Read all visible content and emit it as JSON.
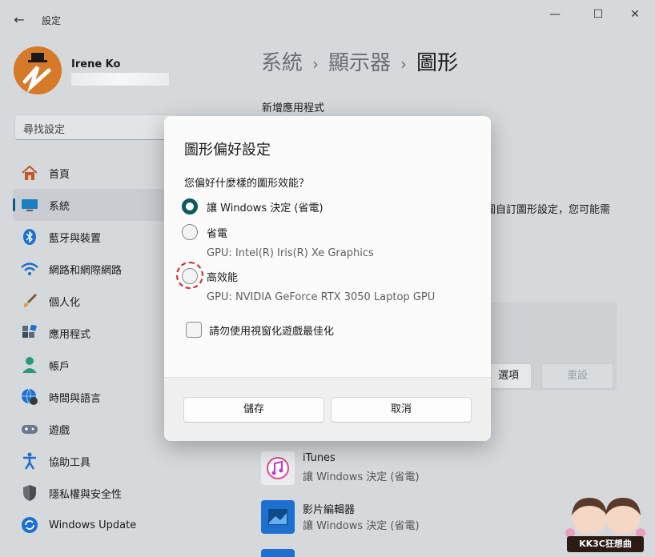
{
  "window": {
    "title": "設定",
    "back_glyph": "←",
    "minimize_glyph": "—",
    "maximize_glyph": "☐",
    "close_glyph": "✕"
  },
  "profile": {
    "name": "Irene Ko"
  },
  "search": {
    "placeholder": "尋找設定"
  },
  "sidebar": {
    "items": [
      {
        "label": "首頁",
        "icon": "home-icon"
      },
      {
        "label": "系統",
        "icon": "monitor-icon",
        "selected": true
      },
      {
        "label": "藍牙與裝置",
        "icon": "bluetooth-icon"
      },
      {
        "label": "網路和網際網路",
        "icon": "wifi-icon"
      },
      {
        "label": "個人化",
        "icon": "brush-icon"
      },
      {
        "label": "應用程式",
        "icon": "apps-icon"
      },
      {
        "label": "帳戶",
        "icon": "person-icon"
      },
      {
        "label": "時間與語言",
        "icon": "globe-clock-icon"
      },
      {
        "label": "遊戲",
        "icon": "gamepad-icon"
      },
      {
        "label": "協助工具",
        "icon": "accessibility-icon"
      },
      {
        "label": "隱私權與安全性",
        "icon": "shield-icon"
      },
      {
        "label": "Windows Update",
        "icon": "update-icon"
      }
    ]
  },
  "breadcrumb": {
    "part1": "系統",
    "part2": "顯示器",
    "part3": "圖形",
    "separator": "›"
  },
  "main": {
    "section_heading": "新增應用程式",
    "truncated_text": "圍自訂圖形設定，您可能需",
    "options_button": "選項",
    "reset_button": "重設",
    "apps": [
      {
        "name": "iTunes",
        "pref": "讓 Windows 決定 (省電)",
        "icon": "itunes-icon"
      },
      {
        "name": "影片編輯器",
        "pref": "讓 Windows 決定 (省電)",
        "icon": "video-editor-icon"
      }
    ]
  },
  "dialog": {
    "title": "圖形偏好設定",
    "question": "您偏好什麼樣的圖形效能？",
    "options": [
      {
        "label": "讓 Windows 決定 (省電)",
        "checked": true,
        "gpu": ""
      },
      {
        "label": "省電",
        "checked": false,
        "gpu": "GPU: Intel(R) Iris(R) Xe Graphics"
      },
      {
        "label": "高效能",
        "checked": false,
        "gpu": "GPU: NVIDIA GeForce RTX 3050 Laptop GPU"
      }
    ],
    "checkbox_label": "請勿使用視窗化遊戲最佳化",
    "save_label": "儲存",
    "cancel_label": "取消"
  },
  "watermark": {
    "text": "KK3C狂想曲"
  },
  "colors": {
    "accent": "#0a5a5f",
    "highlight_ring": "#d92020"
  }
}
